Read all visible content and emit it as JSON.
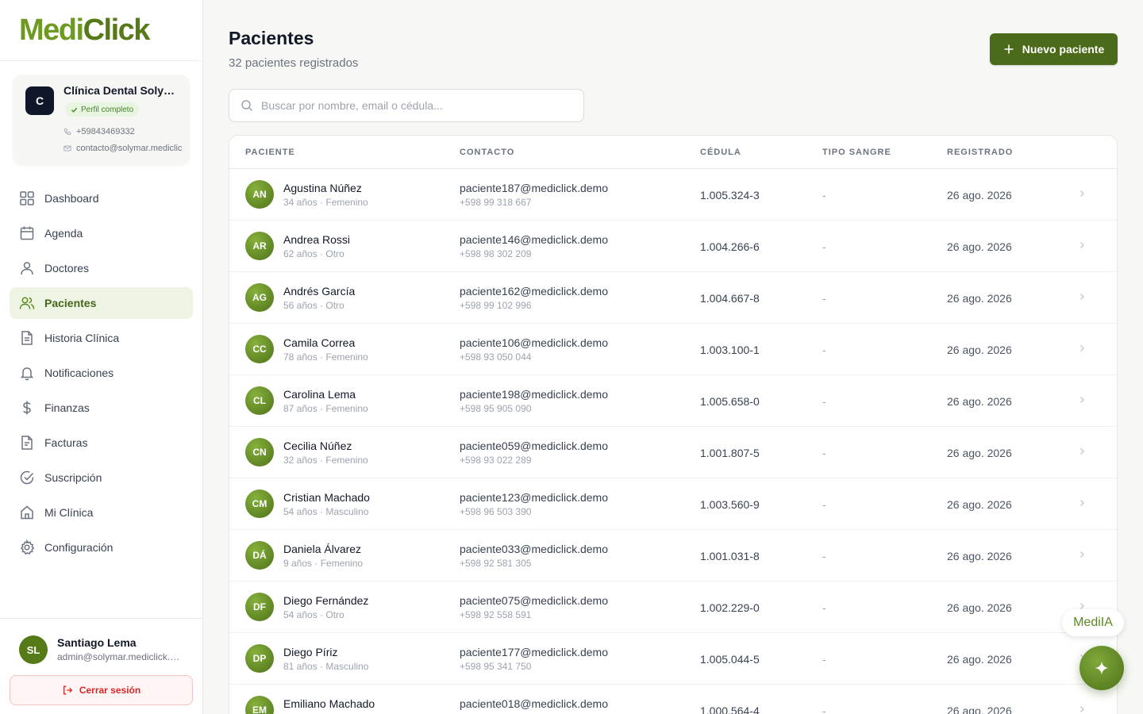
{
  "brand": {
    "part1": "Medi",
    "part2": "Click"
  },
  "clinic": {
    "initial": "C",
    "name": "Clínica Dental Solymar",
    "badge": "Perfil completo",
    "phone": "+59843469332",
    "email": "contacto@solymar.mediclick.demo"
  },
  "nav": [
    {
      "label": "Dashboard",
      "icon": "grid-icon"
    },
    {
      "label": "Agenda",
      "icon": "calendar-icon"
    },
    {
      "label": "Doctores",
      "icon": "user-icon"
    },
    {
      "label": "Pacientes",
      "icon": "users-icon"
    },
    {
      "label": "Historia Clínica",
      "icon": "file-icon"
    },
    {
      "label": "Notificaciones",
      "icon": "bell-icon"
    },
    {
      "label": "Finanzas",
      "icon": "dollar-icon"
    },
    {
      "label": "Facturas",
      "icon": "invoice-icon"
    },
    {
      "label": "Suscripción",
      "icon": "check-circle-icon"
    },
    {
      "label": "Mi Clínica",
      "icon": "home-icon"
    },
    {
      "label": "Configuración",
      "icon": "gear-icon"
    }
  ],
  "active_nav": "Pacientes",
  "user": {
    "initials": "SL",
    "name": "Santiago Lema",
    "email": "admin@solymar.mediclick.demo",
    "logout_label": "Cerrar sesión"
  },
  "page": {
    "title": "Pacientes",
    "subtitle": "32 pacientes registrados",
    "new_button": "Nuevo paciente",
    "search_placeholder": "Buscar por nombre, email o cédula..."
  },
  "table": {
    "headers": [
      "PACIENTE",
      "CONTACTO",
      "CÉDULA",
      "TIPO SANGRE",
      "REGISTRADO"
    ],
    "rows": [
      {
        "initials": "AN",
        "name": "Agustina Núñez",
        "meta": "34 años · Femenino",
        "email": "paciente187@mediclick.demo",
        "phone": "+598 99 318 667",
        "cedula": "1.005.324-3",
        "blood": "-",
        "registered": "26 ago. 2026"
      },
      {
        "initials": "AR",
        "name": "Andrea Rossi",
        "meta": "62 años · Otro",
        "email": "paciente146@mediclick.demo",
        "phone": "+598 98 302 209",
        "cedula": "1.004.266-6",
        "blood": "-",
        "registered": "26 ago. 2026"
      },
      {
        "initials": "AG",
        "name": "Andrés García",
        "meta": "56 años · Otro",
        "email": "paciente162@mediclick.demo",
        "phone": "+598 99 102 996",
        "cedula": "1.004.667-8",
        "blood": "-",
        "registered": "26 ago. 2026"
      },
      {
        "initials": "CC",
        "name": "Camila Correa",
        "meta": "78 años · Femenino",
        "email": "paciente106@mediclick.demo",
        "phone": "+598 93 050 044",
        "cedula": "1.003.100-1",
        "blood": "-",
        "registered": "26 ago. 2026"
      },
      {
        "initials": "CL",
        "name": "Carolina Lema",
        "meta": "87 años · Femenino",
        "email": "paciente198@mediclick.demo",
        "phone": "+598 95 905 090",
        "cedula": "1.005.658-0",
        "blood": "-",
        "registered": "26 ago. 2026"
      },
      {
        "initials": "CN",
        "name": "Cecilia Núñez",
        "meta": "32 años · Femenino",
        "email": "paciente059@mediclick.demo",
        "phone": "+598 93 022 289",
        "cedula": "1.001.807-5",
        "blood": "-",
        "registered": "26 ago. 2026"
      },
      {
        "initials": "CM",
        "name": "Cristian Machado",
        "meta": "54 años · Masculino",
        "email": "paciente123@mediclick.demo",
        "phone": "+598 96 503 390",
        "cedula": "1.003.560-9",
        "blood": "-",
        "registered": "26 ago. 2026"
      },
      {
        "initials": "DÁ",
        "name": "Daniela Álvarez",
        "meta": "9 años · Femenino",
        "email": "paciente033@mediclick.demo",
        "phone": "+598 92 581 305",
        "cedula": "1.001.031-8",
        "blood": "-",
        "registered": "26 ago. 2026"
      },
      {
        "initials": "DF",
        "name": "Diego Fernández",
        "meta": "54 años · Otro",
        "email": "paciente075@mediclick.demo",
        "phone": "+598 92 558 591",
        "cedula": "1.002.229-0",
        "blood": "-",
        "registered": "26 ago. 2026"
      },
      {
        "initials": "DP",
        "name": "Diego Píriz",
        "meta": "81 años · Masculino",
        "email": "paciente177@mediclick.demo",
        "phone": "+598 95 341 750",
        "cedula": "1.005.044-5",
        "blood": "-",
        "registered": "26 ago. 2026"
      },
      {
        "initials": "EM",
        "name": "Emiliano Machado",
        "meta": "",
        "email": "paciente018@mediclick.demo",
        "phone": "",
        "cedula": "1.000.564-4",
        "blood": "-",
        "registered": "26 ago. 2026"
      }
    ]
  },
  "assistant": {
    "label": "MediIA"
  },
  "colors": {
    "brand": "#557a17",
    "brand_light": "#6e9a22",
    "button": "#4b6a1a",
    "danger": "#dc2626"
  }
}
